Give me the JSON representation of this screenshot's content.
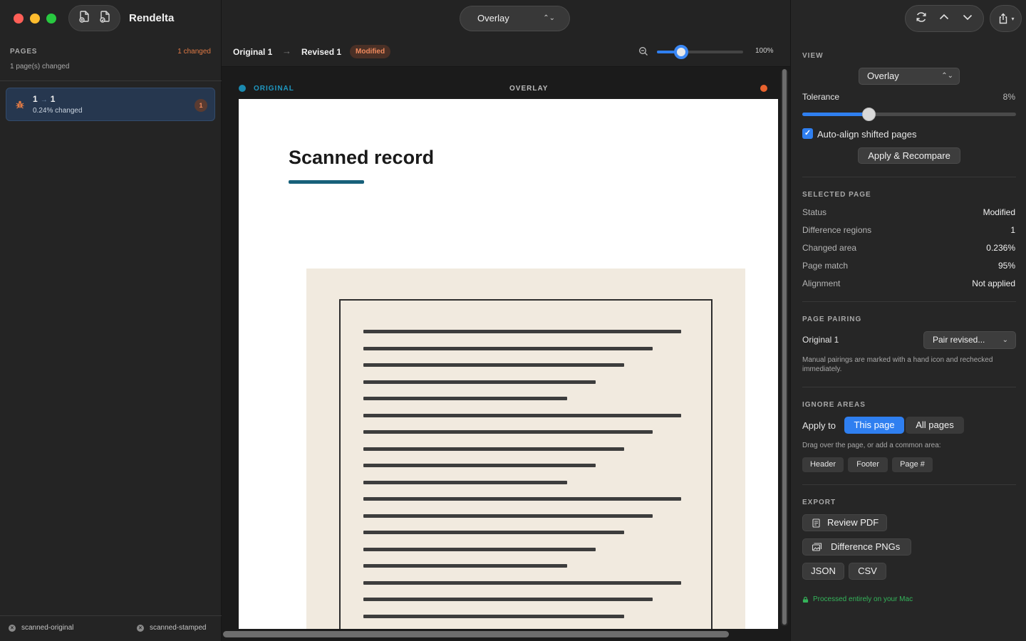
{
  "app": {
    "title": "Rendelta"
  },
  "sidebar": {
    "pages_header": "PAGES",
    "changed_count": "1 changed",
    "summary": "1 page(s) changed",
    "pages": [
      {
        "original": "1",
        "arrow": "→",
        "revised": "1",
        "change": "0.24% changed",
        "regions": "1"
      }
    ],
    "footer": {
      "original_file": "scanned-original",
      "revised_file": "scanned-stamped"
    }
  },
  "toolbar": {
    "mode": "Overlay"
  },
  "breadcrumb": {
    "original": "Original 1",
    "arrow": "→",
    "revised": "Revised 1",
    "status": "Modified",
    "zoom": "100%",
    "zoom_level": 0.28
  },
  "canvas": {
    "legend_original": "ORIGINAL",
    "legend_overlay": "OVERLAY",
    "colors": {
      "original": "#1b8ab0",
      "revised": "#e8622e"
    },
    "document_title": "Scanned record"
  },
  "inspector": {
    "view": {
      "title": "VIEW",
      "mode": "Overlay",
      "tolerance_label": "Tolerance",
      "tolerance_value": "8%",
      "tolerance_level": 0.31,
      "auto_align_label": "Auto-align shifted pages",
      "auto_align_checked": true,
      "apply_label": "Apply & Recompare"
    },
    "selected_page": {
      "title": "SELECTED PAGE",
      "rows": [
        {
          "label": "Status",
          "value": "Modified"
        },
        {
          "label": "Difference regions",
          "value": "1"
        },
        {
          "label": "Changed area",
          "value": "0.236%"
        },
        {
          "label": "Page match",
          "value": "95%"
        },
        {
          "label": "Alignment",
          "value": "Not applied"
        }
      ]
    },
    "pairing": {
      "title": "PAGE PAIRING",
      "label": "Original 1",
      "select": "Pair revised...",
      "note": "Manual pairings are marked with a hand icon and rechecked immediately."
    },
    "ignore": {
      "title": "IGNORE AREAS",
      "apply_to": "Apply to",
      "this_page": "This page",
      "all_pages": "All pages",
      "note": "Drag over the page, or add a common area:",
      "chips": [
        "Header",
        "Footer",
        "Page #"
      ]
    },
    "export": {
      "title": "EXPORT",
      "review_pdf": "Review PDF",
      "diff_pngs": "Difference PNGs",
      "json": "JSON",
      "csv": "CSV",
      "privacy": "Processed entirely on your Mac"
    }
  }
}
